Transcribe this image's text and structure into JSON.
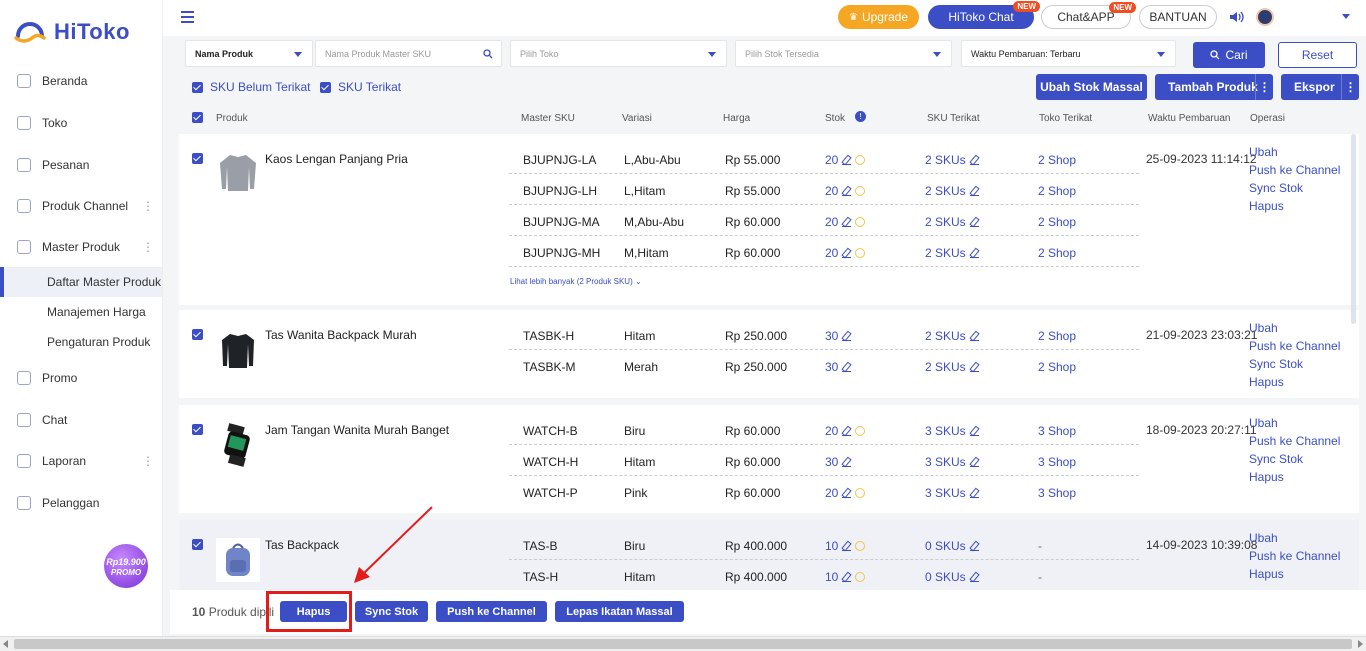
{
  "brand": {
    "name": "HiToko",
    "accent": "#3b4ec5",
    "annotation_color": "#e21b1b"
  },
  "sidebar": {
    "items": [
      {
        "label": "Beranda",
        "icon": "monitor-icon"
      },
      {
        "label": "Toko",
        "icon": "store-icon"
      },
      {
        "label": "Pesanan",
        "icon": "order-icon"
      },
      {
        "label": "Produk Channel",
        "icon": "grid-icon"
      },
      {
        "label": "Master Produk",
        "icon": "box-icon"
      },
      {
        "label": "Promo",
        "icon": "promo-icon"
      },
      {
        "label": "Chat",
        "icon": "chat-icon"
      },
      {
        "label": "Laporan",
        "icon": "report-icon"
      },
      {
        "label": "Pelanggan",
        "icon": "customer-icon"
      }
    ],
    "sub_items": [
      "Daftar Master Produk",
      "Manajemen Harga",
      "Pengaturan Produk"
    ],
    "promo_price": "Rp19.900",
    "promo_label": "PROMO"
  },
  "topbar": {
    "upgrade": "Upgrade",
    "hitoko_chat": "HiToko Chat",
    "chat_app": "Chat&APP",
    "bantuan": "BANTUAN",
    "new_badge": "NEW"
  },
  "filters": {
    "field": "Nama Produk",
    "search_placeholder": "Nama Produk Master SKU",
    "toko_placeholder": "Pilih Toko",
    "stok_placeholder": "Pilih Stok Tersedia",
    "sort": "Waktu Pembaruan: Terbaru",
    "search_button": "Cari",
    "reset_button": "Reset"
  },
  "sku_filters": [
    "SKU Belum Terikat",
    "SKU Terikat"
  ],
  "actions": {
    "bulk_stock": "Ubah Stok Massal",
    "add_product": "Tambah Produk",
    "export": "Ekspor"
  },
  "table_headers": [
    "Produk",
    "Master SKU",
    "Variasi",
    "Harga",
    "Stok",
    "SKU Terikat",
    "Toko Terikat",
    "Waktu Pembaruan",
    "Operasi"
  ],
  "products": [
    {
      "name": "Kaos Lengan Panjang Pria",
      "time": "25-09-2023 11:14:12",
      "more": "Lihat lebih banyak (2 Produk SKU)",
      "ops": [
        "Ubah",
        "Push ke Channel",
        "Sync Stok",
        "Hapus"
      ],
      "rows": [
        {
          "sku": "BJUPNJG-LA",
          "variant": "L,Abu-Abu",
          "price": "Rp 55.000",
          "stock": "20",
          "bound": "2 SKUs",
          "shop": "2 Shop"
        },
        {
          "sku": "BJUPNJG-LH",
          "variant": "L,Hitam",
          "price": "Rp 55.000",
          "stock": "20",
          "bound": "2 SKUs",
          "shop": "2 Shop"
        },
        {
          "sku": "BJUPNJG-MA",
          "variant": "M,Abu-Abu",
          "price": "Rp 60.000",
          "stock": "20",
          "bound": "2 SKUs",
          "shop": "2 Shop"
        },
        {
          "sku": "BJUPNJG-MH",
          "variant": "M,Hitam",
          "price": "Rp 60.000",
          "stock": "20",
          "bound": "2 SKUs",
          "shop": "2 Shop"
        }
      ]
    },
    {
      "name": "Tas Wanita Backpack Murah",
      "time": "21-09-2023 23:03:21",
      "ops": [
        "Ubah",
        "Push ke Channel",
        "Sync Stok",
        "Hapus"
      ],
      "rows": [
        {
          "sku": "TASBK-H",
          "variant": "Hitam",
          "price": "Rp 250.000",
          "stock": "30",
          "bound": "2 SKUs",
          "shop": "2 Shop"
        },
        {
          "sku": "TASBK-M",
          "variant": "Merah",
          "price": "Rp 250.000",
          "stock": "30",
          "bound": "2 SKUs",
          "shop": "2 Shop"
        }
      ]
    },
    {
      "name": "Jam Tangan Wanita Murah Banget",
      "time": "18-09-2023 20:27:11",
      "ops": [
        "Ubah",
        "Push ke Channel",
        "Sync Stok",
        "Hapus"
      ],
      "rows": [
        {
          "sku": "WATCH-B",
          "variant": "Biru",
          "price": "Rp 60.000",
          "stock": "20",
          "bound": "3 SKUs",
          "shop": "3 Shop"
        },
        {
          "sku": "WATCH-H",
          "variant": "Hitam",
          "price": "Rp 60.000",
          "stock": "30",
          "bound": "3 SKUs",
          "shop": "3 Shop"
        },
        {
          "sku": "WATCH-P",
          "variant": "Pink",
          "price": "Rp 60.000",
          "stock": "20",
          "bound": "3 SKUs",
          "shop": "3 Shop"
        }
      ]
    },
    {
      "name": "Tas Backpack",
      "time": "14-09-2023 10:39:08",
      "ops": [
        "Ubah",
        "Push ke Channel",
        "Hapus"
      ],
      "rows": [
        {
          "sku": "TAS-B",
          "variant": "Biru",
          "price": "Rp 400.000",
          "stock": "10",
          "bound": "0 SKUs",
          "shop": "-"
        },
        {
          "sku": "TAS-H",
          "variant": "Hitam",
          "price": "Rp 400.000",
          "stock": "10",
          "bound": "0 SKUs",
          "shop": "-"
        }
      ]
    }
  ],
  "bottom": {
    "selected_count": "10",
    "selected_text": "Produk dipili",
    "delete": "Hapus",
    "sync": "Sync Stok",
    "push": "Push ke Channel",
    "unbind": "Lepas Ikatan Massal"
  }
}
